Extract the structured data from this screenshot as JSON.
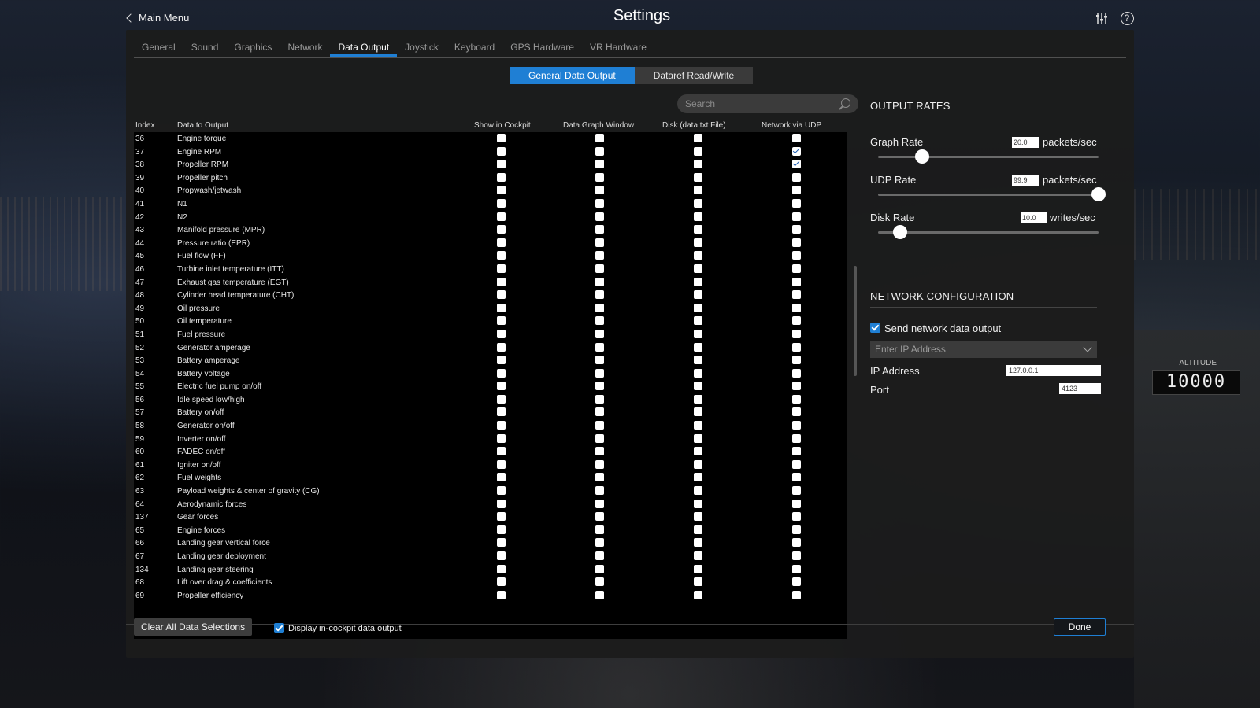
{
  "header": {
    "back_label": "Main Menu",
    "title": "Settings",
    "icons": [
      "sliders-icon",
      "help-icon"
    ],
    "help_glyph": "?"
  },
  "tabs": [
    {
      "label": "General",
      "active": false
    },
    {
      "label": "Sound",
      "active": false
    },
    {
      "label": "Graphics",
      "active": false
    },
    {
      "label": "Network",
      "active": false
    },
    {
      "label": "Data Output",
      "active": true
    },
    {
      "label": "Joystick",
      "active": false
    },
    {
      "label": "Keyboard",
      "active": false
    },
    {
      "label": "GPS Hardware",
      "active": false
    },
    {
      "label": "VR Hardware",
      "active": false
    }
  ],
  "subtabs": [
    {
      "label": "General Data Output",
      "active": true
    },
    {
      "label": "Dataref Read/Write",
      "active": false
    }
  ],
  "search": {
    "placeholder": "Search"
  },
  "table": {
    "headers": {
      "index": "Index",
      "name": "Data to Output",
      "cockpit": "Show in Cockpit",
      "graph": "Data Graph Window",
      "disk": "Disk (data.txt File)",
      "udp": "Network via UDP"
    },
    "rows": [
      {
        "index": "36",
        "name": "Engine torque",
        "checks": [
          false,
          false,
          false,
          false
        ]
      },
      {
        "index": "37",
        "name": "Engine RPM",
        "checks": [
          false,
          false,
          false,
          true
        ]
      },
      {
        "index": "38",
        "name": "Propeller RPM",
        "checks": [
          false,
          false,
          false,
          true
        ]
      },
      {
        "index": "39",
        "name": "Propeller pitch",
        "checks": [
          false,
          false,
          false,
          false
        ]
      },
      {
        "index": "40",
        "name": "Propwash/jetwash",
        "checks": [
          false,
          false,
          false,
          false
        ]
      },
      {
        "index": "41",
        "name": "N1",
        "checks": [
          false,
          false,
          false,
          false
        ]
      },
      {
        "index": "42",
        "name": "N2",
        "checks": [
          false,
          false,
          false,
          false
        ]
      },
      {
        "index": "43",
        "name": "Manifold pressure (MPR)",
        "checks": [
          false,
          false,
          false,
          false
        ]
      },
      {
        "index": "44",
        "name": "Pressure ratio (EPR)",
        "checks": [
          false,
          false,
          false,
          false
        ]
      },
      {
        "index": "45",
        "name": "Fuel flow (FF)",
        "checks": [
          false,
          false,
          false,
          false
        ]
      },
      {
        "index": "46",
        "name": "Turbine inlet temperature (ITT)",
        "checks": [
          false,
          false,
          false,
          false
        ]
      },
      {
        "index": "47",
        "name": "Exhaust gas temperature (EGT)",
        "checks": [
          false,
          false,
          false,
          false
        ]
      },
      {
        "index": "48",
        "name": "Cylinder head temperature (CHT)",
        "checks": [
          false,
          false,
          false,
          false
        ]
      },
      {
        "index": "49",
        "name": "Oil pressure",
        "checks": [
          false,
          false,
          false,
          false
        ]
      },
      {
        "index": "50",
        "name": "Oil temperature",
        "checks": [
          false,
          false,
          false,
          false
        ]
      },
      {
        "index": "51",
        "name": "Fuel pressure",
        "checks": [
          false,
          false,
          false,
          false
        ]
      },
      {
        "index": "52",
        "name": "Generator amperage",
        "checks": [
          false,
          false,
          false,
          false
        ]
      },
      {
        "index": "53",
        "name": "Battery amperage",
        "checks": [
          false,
          false,
          false,
          false
        ]
      },
      {
        "index": "54",
        "name": "Battery voltage",
        "checks": [
          false,
          false,
          false,
          false
        ]
      },
      {
        "index": "55",
        "name": "Electric fuel pump on/off",
        "checks": [
          false,
          false,
          false,
          false
        ]
      },
      {
        "index": "56",
        "name": "Idle speed low/high",
        "checks": [
          false,
          false,
          false,
          false
        ]
      },
      {
        "index": "57",
        "name": "Battery on/off",
        "checks": [
          false,
          false,
          false,
          false
        ]
      },
      {
        "index": "58",
        "name": "Generator on/off",
        "checks": [
          false,
          false,
          false,
          false
        ]
      },
      {
        "index": "59",
        "name": "Inverter on/off",
        "checks": [
          false,
          false,
          false,
          false
        ]
      },
      {
        "index": "60",
        "name": "FADEC on/off",
        "checks": [
          false,
          false,
          false,
          false
        ]
      },
      {
        "index": "61",
        "name": "Igniter on/off",
        "checks": [
          false,
          false,
          false,
          false
        ]
      },
      {
        "index": "62",
        "name": "Fuel weights",
        "checks": [
          false,
          false,
          false,
          false
        ]
      },
      {
        "index": "63",
        "name": "Payload weights & center of gravity (CG)",
        "checks": [
          false,
          false,
          false,
          false
        ]
      },
      {
        "index": "64",
        "name": "Aerodynamic forces",
        "checks": [
          false,
          false,
          false,
          false
        ]
      },
      {
        "index": "137",
        "name": "Gear forces",
        "checks": [
          false,
          false,
          false,
          false
        ]
      },
      {
        "index": "65",
        "name": "Engine forces",
        "checks": [
          false,
          false,
          false,
          false
        ]
      },
      {
        "index": "66",
        "name": "Landing gear vertical force",
        "checks": [
          false,
          false,
          false,
          false
        ]
      },
      {
        "index": "67",
        "name": "Landing gear deployment",
        "checks": [
          false,
          false,
          false,
          false
        ]
      },
      {
        "index": "134",
        "name": "Landing gear steering",
        "checks": [
          false,
          false,
          false,
          false
        ]
      },
      {
        "index": "68",
        "name": "Lift over drag & coefficients",
        "checks": [
          false,
          false,
          false,
          false
        ]
      },
      {
        "index": "69",
        "name": "Propeller efficiency",
        "checks": [
          false,
          false,
          false,
          false
        ]
      }
    ]
  },
  "output_rates": {
    "title": "OUTPUT RATES",
    "graph": {
      "label": "Graph Rate",
      "value": "20.0",
      "unit": "packets/sec",
      "slider_fraction": 0.2
    },
    "udp": {
      "label": "UDP Rate",
      "value": "99.9",
      "unit": "packets/sec",
      "slider_fraction": 1.0
    },
    "disk": {
      "label": "Disk Rate",
      "value": "10.0",
      "unit": "writes/sec",
      "slider_fraction": 0.1
    }
  },
  "network": {
    "title": "NETWORK CONFIGURATION",
    "send_label": "Send network data output",
    "send_checked": true,
    "ip_dropdown_placeholder": "Enter IP Address",
    "ip_label": "IP Address",
    "ip_value": "127.0.0.1",
    "port_label": "Port",
    "port_value": "4123"
  },
  "footer": {
    "clear_label": "Clear All Data Selections",
    "display_label": "Display in-cockpit data output",
    "display_checked": true,
    "done_label": "Done"
  },
  "background": {
    "altitude_label": "ALTITUDE",
    "altitude_value": "10000"
  },
  "colors": {
    "accent": "#1f7fd4",
    "panel": "#1c1c1c",
    "table_bg": "#000000"
  }
}
